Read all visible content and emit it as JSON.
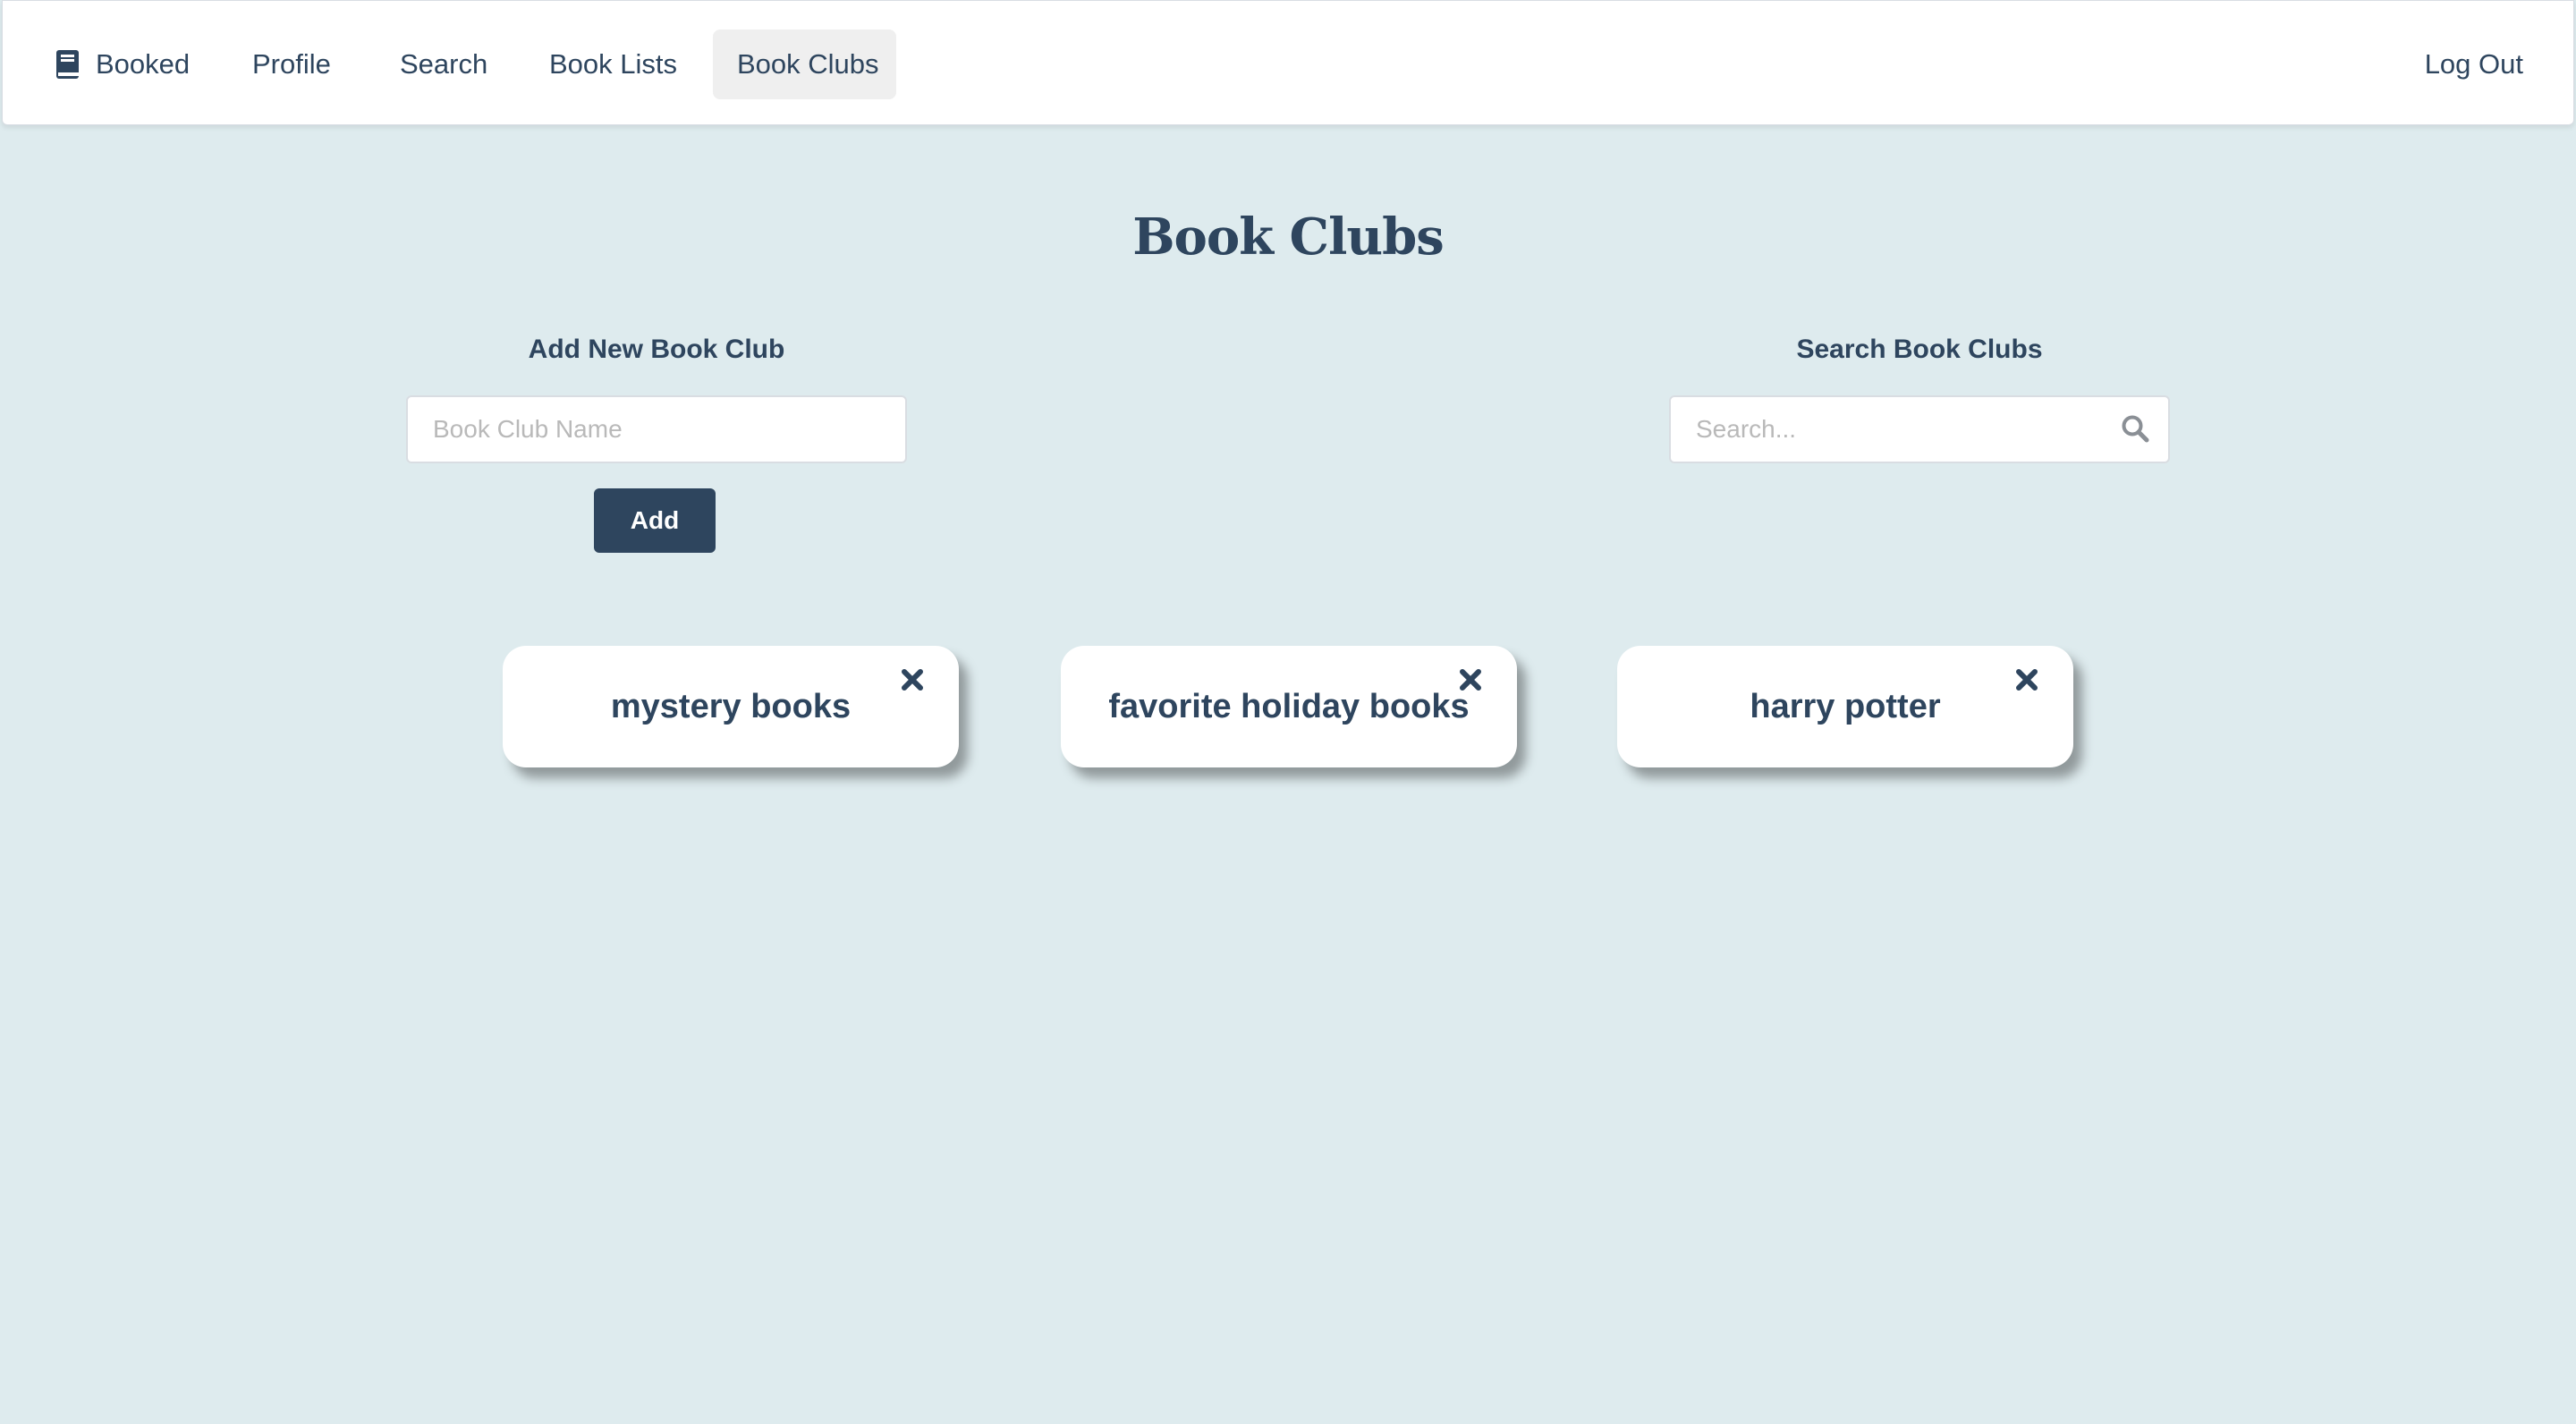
{
  "nav": {
    "brand_icon": "book-icon",
    "brand_label": "Booked",
    "items": [
      {
        "label": "Profile"
      },
      {
        "label": "Search"
      },
      {
        "label": "Book Lists"
      },
      {
        "label": "Book Clubs",
        "active": true
      }
    ],
    "logout_label": "Log Out"
  },
  "page": {
    "title": "Book Clubs"
  },
  "add_club": {
    "label": "Add New Book Club",
    "input_placeholder": "Book Club Name",
    "input_value": "",
    "button_label": "Add"
  },
  "search_clubs": {
    "label": "Search Book Clubs",
    "input_placeholder": "Search...",
    "input_value": "",
    "icon": "search-icon"
  },
  "clubs": [
    {
      "name": "mystery books",
      "remove_icon": "close-icon"
    },
    {
      "name": "favorite holiday books",
      "remove_icon": "close-icon"
    },
    {
      "name": "harry potter",
      "remove_icon": "close-icon"
    }
  ],
  "colors": {
    "background": "#deebee",
    "primary_text": "#2e455e",
    "button": "#2e455e",
    "nav_active": "#efefef",
    "card": "#ffffff"
  }
}
